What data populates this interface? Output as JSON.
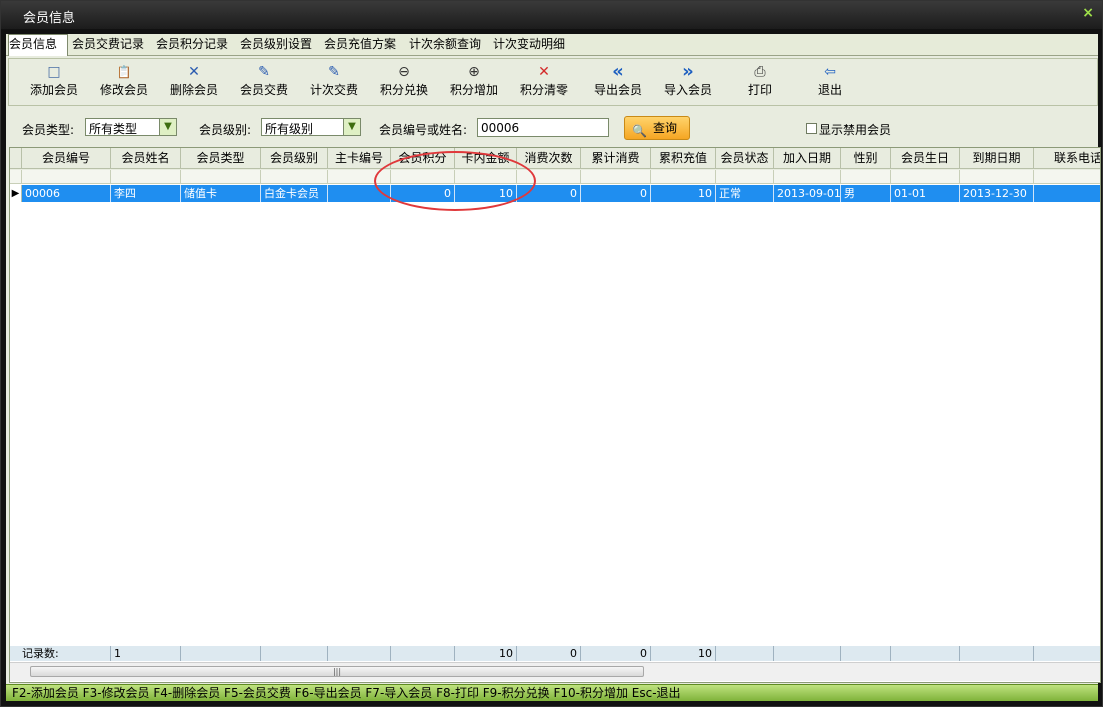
{
  "window": {
    "title": "会员信息",
    "close": "×"
  },
  "tabs": [
    "会员信息",
    "会员交费记录",
    "会员积分记录",
    "会员级别设置",
    "会员充值方案",
    "计次余额查询",
    "计次变动明细"
  ],
  "toolbar": [
    {
      "label": "添加会员",
      "icon": "□"
    },
    {
      "label": "修改会员",
      "icon": "📋"
    },
    {
      "label": "删除会员",
      "icon": "✕"
    },
    {
      "label": "会员交费",
      "icon": "✎"
    },
    {
      "label": "计次交费",
      "icon": "✎"
    },
    {
      "label": "积分兑换",
      "icon": "⊖"
    },
    {
      "label": "积分增加",
      "icon": "⊕"
    },
    {
      "label": "积分清零",
      "icon": "✕"
    },
    {
      "label": "导出会员",
      "icon": "«"
    },
    {
      "label": "导入会员",
      "icon": "»"
    },
    {
      "label": "打印",
      "icon": "⎙"
    },
    {
      "label": "退出",
      "icon": "⇦"
    }
  ],
  "filters": {
    "type_label": "会员类型:",
    "type_value": "所有类型",
    "level_label": "会员级别:",
    "level_value": "所有级别",
    "search_label": "会员编号或姓名:",
    "search_value": "00006",
    "query_label": "查询",
    "query_icon": "🔍",
    "show_disabled_label": "显示禁用会员"
  },
  "grid": {
    "columns": [
      "会员编号",
      "会员姓名",
      "会员类型",
      "会员级别",
      "主卡编号",
      "会员积分",
      "卡内金额",
      "消费次数",
      "累计消费",
      "累积充值",
      "会员状态",
      "加入日期",
      "性别",
      "会员生日",
      "到期日期",
      "联系电话"
    ],
    "rows": [
      [
        "00006",
        "李四",
        "储值卡",
        "白金卡会员",
        "",
        "0",
        "10",
        "0",
        "0",
        "10",
        "正常",
        "2013-09-01",
        "男",
        "01-01",
        "2013-12-30",
        ""
      ]
    ],
    "row_indicator": "▶",
    "footer": [
      "记录数:",
      "1",
      "",
      "",
      "",
      "",
      "10",
      "0",
      "0",
      "10",
      "",
      "",
      "",
      "",
      "",
      ""
    ],
    "scroll_grip": "|||"
  },
  "statusbar": "F2-添加会员 F3-修改会员 F4-删除会员 F5-会员交费 F6-导出会员 F7-导入会员 F8-打印 F9-积分兑换 F10-积分增加 Esc-退出",
  "colors": {
    "selected_row": "#1f8ef0",
    "status_bar": "#9ccc55",
    "annotation": "#e0383b"
  }
}
